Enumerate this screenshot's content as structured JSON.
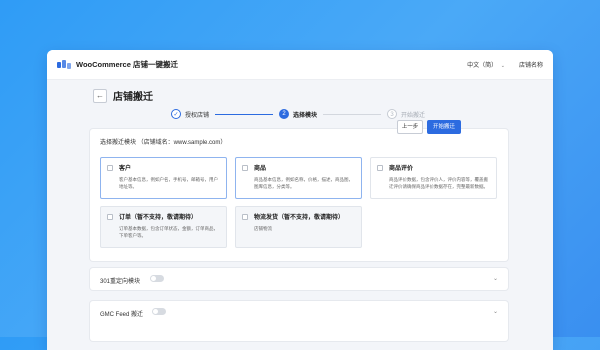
{
  "app": {
    "title": "WooCommerce 店铺一键搬迁",
    "language": "中文（简）",
    "shop_name": "店铺名称"
  },
  "page": {
    "title": "店铺搬迁"
  },
  "steps": [
    {
      "index": "✓",
      "label": "授权店铺",
      "status": "done"
    },
    {
      "index": "2",
      "label": "选择模块",
      "status": "active"
    },
    {
      "index": "3",
      "label": "开始搬迁",
      "status": "todo"
    }
  ],
  "module_panel": {
    "header": "选择搬迁模块 （店铺域名：www.sample.com）",
    "modules": [
      {
        "title": "客户",
        "desc": "客户基本信息，例如户名，手机号，邮箱号，用户地址等。"
      },
      {
        "title": "商品",
        "desc": "商品基本信息，例如名称，价格，描述，商品图，图库信息，分类等。"
      },
      {
        "title": "商品评价",
        "desc": "商品评价数据，包含评价人，评价内容等，覆盖搬迁评价请确保商品评价数据存在，完整最新数据。"
      },
      {
        "title": "订单（暂不支持，敬请期待）",
        "desc": "订单基本数据，包含订单状态，金额，订单商品，下单客户等。"
      },
      {
        "title": "物流发货（暂不支持，敬请期待）",
        "desc": "店铺物流"
      }
    ]
  },
  "redirect": {
    "label": "301重定向模块"
  },
  "gmc": {
    "label": "GMC Feed 搬迁"
  },
  "actions": {
    "prev": "上一步",
    "next": "开始搬迁"
  },
  "colors": {
    "accent": "#2c6be0",
    "background": "#3a9bf5"
  }
}
